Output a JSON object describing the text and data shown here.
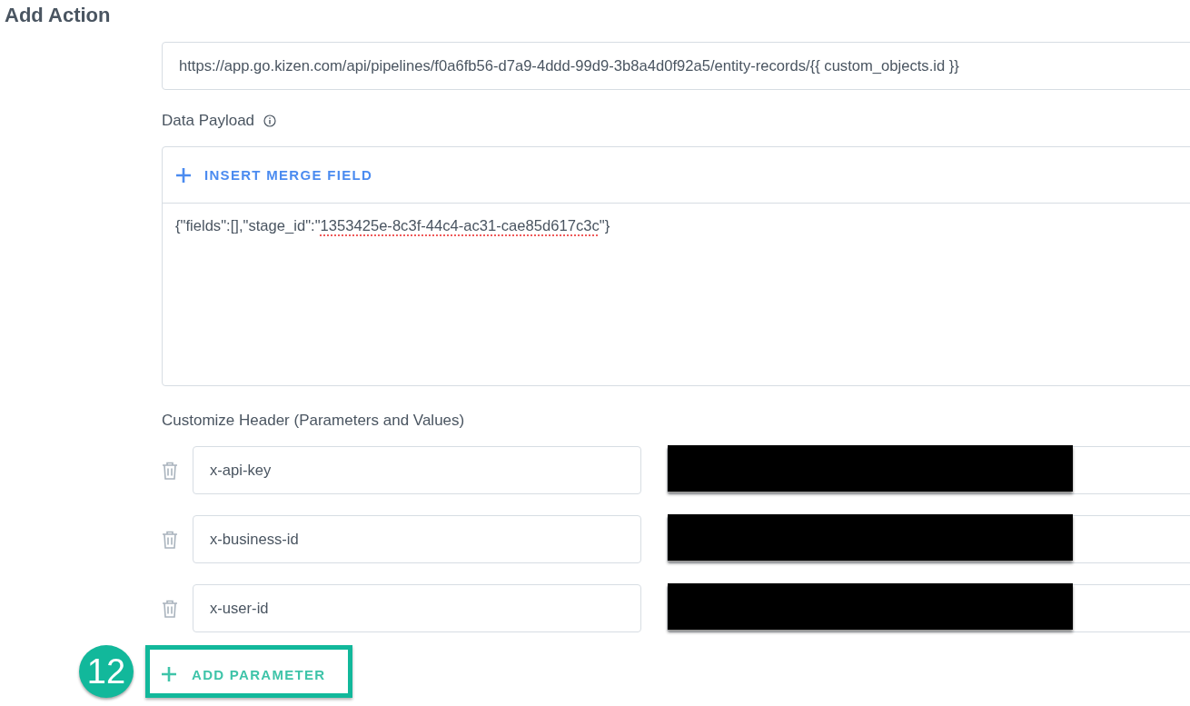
{
  "title": "Add Action",
  "url_field": {
    "value": "https://app.go.kizen.com/api/pipelines/f0a6fb56-d7a9-4ddd-99d9-3b8a4d0f92a5/entity-records/{{ custom_objects.id }}"
  },
  "payload": {
    "label": "Data Payload",
    "insert_button": "INSERT MERGE FIELD",
    "parts": [
      {
        "text": "{\"fields\":[],\"stage_id\":\"",
        "flagged": false
      },
      {
        "text": "1353425e-8c3f-44c4-ac31-cae85d617c3c",
        "flagged": true
      },
      {
        "text": "\"}",
        "flagged": false
      }
    ]
  },
  "headers": {
    "label": "Customize Header (Parameters and Values)",
    "rows": [
      {
        "key": "x-api-key",
        "redacted": true
      },
      {
        "key": "x-business-id",
        "redacted": true
      },
      {
        "key": "x-user-id",
        "redacted": true
      }
    ]
  },
  "add_button": "ADD PARAMETER",
  "annotation": {
    "number": "12"
  }
}
